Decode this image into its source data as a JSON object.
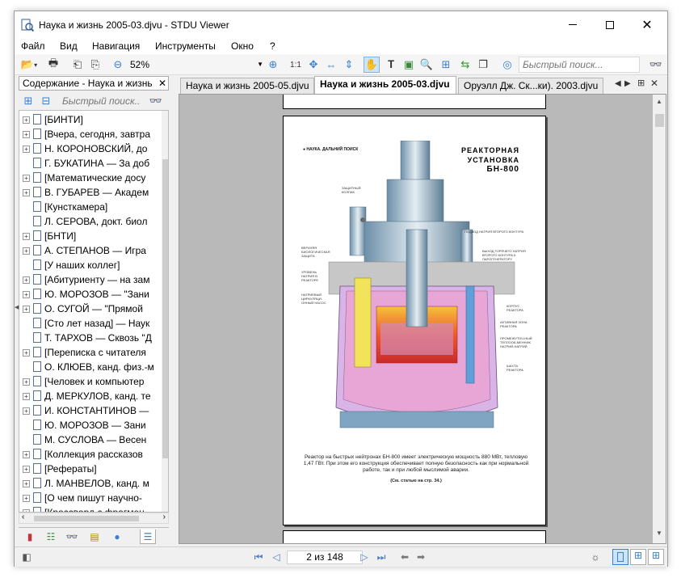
{
  "window": {
    "title": "Наука и жизнь 2005-03.djvu - STDU Viewer"
  },
  "menu": {
    "items": [
      "Файл",
      "Вид",
      "Навигация",
      "Инструменты",
      "Окно",
      "?"
    ]
  },
  "toolbar": {
    "zoom_value": "52%",
    "scale_label": "1:1",
    "quick_search_placeholder": "Быстрый поиск..."
  },
  "sidebar": {
    "header": "Содержание - Наука и жизнь",
    "search_placeholder": "Быстрый поиск...",
    "items": [
      {
        "label": "[БИНТИ]",
        "expandable": true
      },
      {
        "label": "[Вчера, сегодня, завтра",
        "expandable": true
      },
      {
        "label": "Н. КОРОНОВСКИЙ, до",
        "expandable": true
      },
      {
        "label": "Г. БУКАТИНА — За доб",
        "expandable": false
      },
      {
        "label": "[Математические досу",
        "expandable": true
      },
      {
        "label": "В. ГУБАРЕВ — Академ",
        "expandable": true
      },
      {
        "label": "[Кунсткамера]",
        "expandable": false
      },
      {
        "label": "Л. СЕРОВА, докт. биол",
        "expandable": false
      },
      {
        "label": "[БНТИ]",
        "expandable": true
      },
      {
        "label": "А. СТЕПАНОВ — Игра",
        "expandable": true
      },
      {
        "label": "[У наших коллег]",
        "expandable": false
      },
      {
        "label": "[Абитуриенту — на зам",
        "expandable": true
      },
      {
        "label": "Ю. МОРОЗОВ — \"Зани",
        "expandable": true
      },
      {
        "label": "О. СУГОЙ — \"Прямой",
        "expandable": true
      },
      {
        "label": "[Сто лет назад] — Наук",
        "expandable": false
      },
      {
        "label": "Т. ТАРХОВ — Сквозь \"Д",
        "expandable": false
      },
      {
        "label": "[Переписка с читателя",
        "expandable": true
      },
      {
        "label": "О. КЛЮЕВ, канд. физ.-м",
        "expandable": false
      },
      {
        "label": "[Человек и компьютер",
        "expandable": true
      },
      {
        "label": "Д. МЕРКУЛОВ, канд. те",
        "expandable": true
      },
      {
        "label": "И. КОНСТАНТИНОВ —",
        "expandable": true
      },
      {
        "label": "Ю. МОРОЗОВ — Зани",
        "expandable": false
      },
      {
        "label": "М. СУСЛОВА — Весен",
        "expandable": false
      },
      {
        "label": "[Коллекция рассказов",
        "expandable": true
      },
      {
        "label": "[Рефераты]",
        "expandable": true
      },
      {
        "label": "Л. МАНВЕЛОВ, канд. м",
        "expandable": true
      },
      {
        "label": "[О чем пишут научно-",
        "expandable": true
      },
      {
        "label": "[Кроссворд с фрагмен",
        "expandable": true
      }
    ]
  },
  "tabs": [
    {
      "label": "Наука и жизнь 2005-05.djvu",
      "active": false
    },
    {
      "label": "Наука и жизнь 2005-03.djvu",
      "active": true
    },
    {
      "label": "Оруэлл Дж. Ск...ки). 2003.djvu",
      "active": false
    }
  ],
  "page": {
    "header_small": "● НАУКА. ДАЛЬНИЙ ПОИСК",
    "title_line1": "РЕАКТОРНАЯ",
    "title_line2": "УСТАНОВКА",
    "title_line3": "БН-800",
    "labels": {
      "protective_cap": "ЗАЩИТНЫЙ КОЛПАК",
      "upper_shield": "ВЕРХНЯЯ БИОЛОГИЧЕСКАЯ ЗАЩИТА",
      "sodium_level": "УРОВЕНЬ НАТРИЯ В РЕАКТОРЕ",
      "sodium_pump": "НАТРИЕВЫЙ ЦИРКУЛЯЦИ-ОННЫЙ НАСОС",
      "secondary_inlet": "ПОДВОД НАТРИЯ ВТОРОГО КОНТУРА",
      "hot_outlet": "ВЫХОД ГОРЯЧЕГО НАТРИЯ ВТОРОГО КОНТУРА К ПАРОГЕНЕРАТОРУ",
      "vessel": "КОРПУС РЕАКТОРА",
      "active_core": "АКТИВНАЯ ЗОНА РЕАКТОРА",
      "heat_exchanger": "ПРОМЕЖУТОЧ-НЫЙ ТЕПЛООБ-МЕННИК НАТРИЙ-НАТРИЙ",
      "shaft": "ШАХТА РЕАКТОРА"
    },
    "caption": "Реактор на быстрых нейтронах БН-800 имеет электрическую мощность 880 МВт, тепловую 1,47 ГВт. При этом его конструкция обеспечивает полную безопасность как при нормальной работе, так и при любой мыслимой аварии.",
    "caption_ref": "(См. статью на стр. 34.)"
  },
  "status": {
    "page_indicator": "2 из 148"
  },
  "colors": {
    "accent": "#3b7fd0",
    "tab_active_bg": "#ffffff",
    "view_bg": "#b9b9b9"
  }
}
